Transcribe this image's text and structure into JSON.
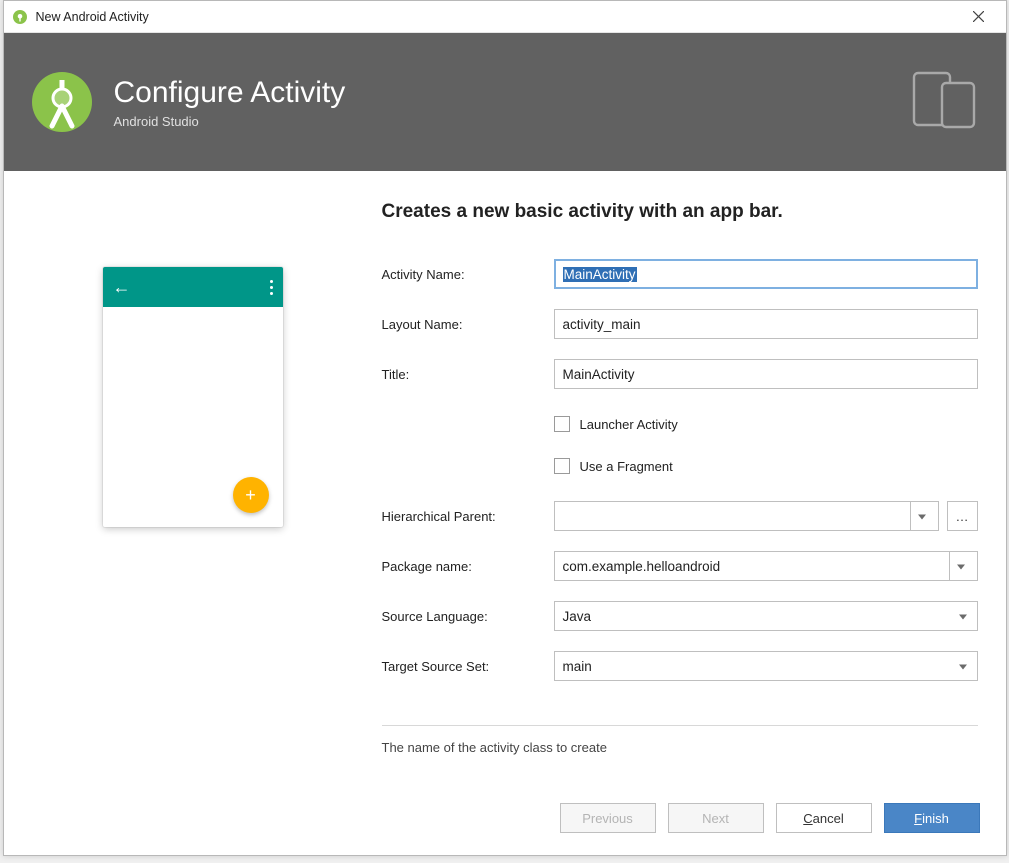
{
  "window": {
    "title": "New Android Activity"
  },
  "banner": {
    "heading": "Configure Activity",
    "subheading": "Android Studio"
  },
  "form": {
    "description": "Creates a new basic activity with an app bar.",
    "activity_name": {
      "label": "Activity Name:",
      "value": "MainActivity"
    },
    "layout_name": {
      "label": "Layout Name:",
      "value": "activity_main"
    },
    "title": {
      "label": "Title:",
      "value": "MainActivity"
    },
    "launcher": {
      "label": "Launcher Activity",
      "checked": false
    },
    "fragment": {
      "label": "Use a Fragment",
      "checked": false
    },
    "hierarchical_parent": {
      "label": "Hierarchical Parent:",
      "value": ""
    },
    "package_name": {
      "label": "Package name:",
      "value": "com.example.helloandroid"
    },
    "source_language": {
      "label": "Source Language:",
      "value": "Java"
    },
    "target_source_set": {
      "label": "Target Source Set:",
      "value": "main"
    },
    "hint": "The name of the activity class to create"
  },
  "buttons": {
    "previous": "Previous",
    "next": "Next",
    "cancel_pre": "",
    "cancel_mn": "C",
    "cancel_post": "ancel",
    "finish_pre": "",
    "finish_mn": "F",
    "finish_post": "inish"
  }
}
